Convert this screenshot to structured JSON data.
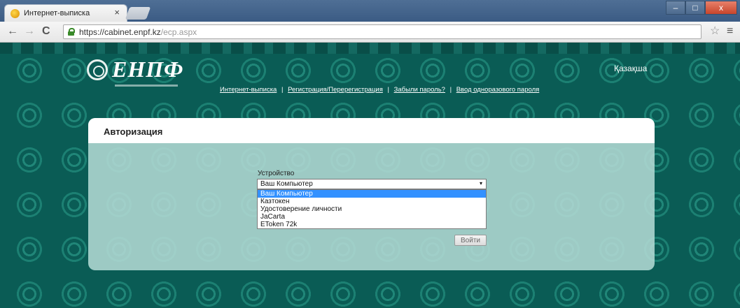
{
  "browser": {
    "tab_title": "Интернет-выписка",
    "tab_close": "×",
    "url_host": "https://cabinet.enpf.kz",
    "url_path": "/ecp.aspx",
    "back": "←",
    "forward": "→",
    "reload": "C",
    "star": "☆",
    "menu": "≡",
    "minimize": "–",
    "maximize": "□",
    "close": "x"
  },
  "header": {
    "logo_text": "ЕНПФ",
    "language_link": "Қазақша",
    "nav": [
      "Интернет-выписка",
      "Регистрация/Перерегистрация",
      "Забыли пароль?",
      "Ввод одноразового пароля"
    ],
    "nav_separator": "|"
  },
  "auth": {
    "title": "Авторизация",
    "device_label": "Устройство",
    "device_selected": "Ваш Компьютер",
    "caret": "▾",
    "options": [
      "Ваш Компьютер",
      "Казтокен",
      "Удостоверение личности",
      "JaCarta",
      "EToken 72k"
    ],
    "login_button": "Войти"
  },
  "colors": {
    "page_bg": "#0a5c55",
    "selected_option": "#3391ff"
  }
}
